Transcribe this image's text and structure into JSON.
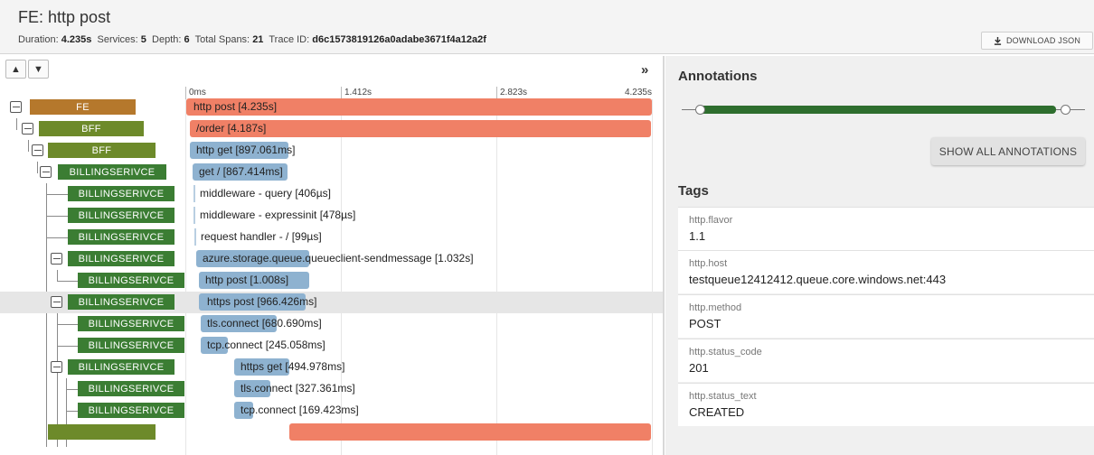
{
  "header": {
    "title_service": "FE",
    "title_op": ": http post",
    "meta": {
      "duration_label": "Duration:",
      "duration": "4.235s",
      "services_label": "Services:",
      "services": "5",
      "depth_label": "Depth:",
      "depth": "6",
      "spans_label": "Total Spans:",
      "spans": "21",
      "trace_label": "Trace ID:",
      "trace_id": "d6c1573819126a0adabe3671f4a12a2f"
    },
    "download_label": "DOWNLOAD JSON"
  },
  "timeline": {
    "ticks": [
      "0ms",
      "1.412s",
      "2.823s"
    ],
    "end_tick": "4.235s",
    "rows": [
      {
        "svc": "FE",
        "label": "http post [4.235s]",
        "color": "#b5782c"
      },
      {
        "svc": "BFF",
        "label": "/order [4.187s]",
        "color": "#6d8a2a"
      },
      {
        "svc": "BFF",
        "label": "http get [897.061ms]",
        "color": "#6d8a2a"
      },
      {
        "svc": "BILLINGSERIVCE",
        "label": "get / [867.414ms]",
        "color": "#3b7d33"
      },
      {
        "svc": "BILLINGSERIVCE",
        "label": "middleware - query [406µs]",
        "color": "#3b7d33"
      },
      {
        "svc": "BILLINGSERIVCE",
        "label": "middleware - expressinit [478µs]",
        "color": "#3b7d33"
      },
      {
        "svc": "BILLINGSERIVCE",
        "label": "request handler - / [99µs]",
        "color": "#3b7d33"
      },
      {
        "svc": "BILLINGSERIVCE",
        "label": "azure.storage.queue.queueclient-sendmessage [1.032s]",
        "color": "#3b7d33"
      },
      {
        "svc": "BILLINGSERIVCE",
        "label": "http post [1.008s]",
        "color": "#3b7d33"
      },
      {
        "svc": "BILLINGSERIVCE",
        "label": "https post [966.426ms]",
        "color": "#3b7d33"
      },
      {
        "svc": "BILLINGSERIVCE",
        "label": "tls.connect [680.690ms]",
        "color": "#3b7d33"
      },
      {
        "svc": "BILLINGSERIVCE",
        "label": "tcp.connect [245.058ms]",
        "color": "#3b7d33"
      },
      {
        "svc": "BILLINGSERIVCE",
        "label": "https get [494.978ms]",
        "color": "#3b7d33"
      },
      {
        "svc": "BILLINGSERIVCE",
        "label": "tls.connect [327.361ms]",
        "color": "#3b7d33"
      },
      {
        "svc": "BILLINGSERIVCE",
        "label": "tcp.connect [169.423ms]",
        "color": "#3b7d33"
      }
    ]
  },
  "annotations": {
    "title": "Annotations",
    "show_all_label": "SHOW ALL ANNOTATIONS"
  },
  "tags": {
    "title": "Tags",
    "items": [
      {
        "key": "http.flavor",
        "value": "1.1"
      },
      {
        "key": "http.host",
        "value": "testqueue12412412.queue.core.windows.net:443"
      },
      {
        "key": "http.method",
        "value": "POST"
      },
      {
        "key": "http.status_code",
        "value": "201"
      },
      {
        "key": "http.status_text",
        "value": "CREATED"
      }
    ]
  },
  "icons": {
    "collapse_up": "chevron-up-icon",
    "collapse_down": "chevron-down-icon",
    "expand_panel": "double-chevron-right-icon",
    "download": "download-icon",
    "toggle": "minus-square-icon"
  }
}
